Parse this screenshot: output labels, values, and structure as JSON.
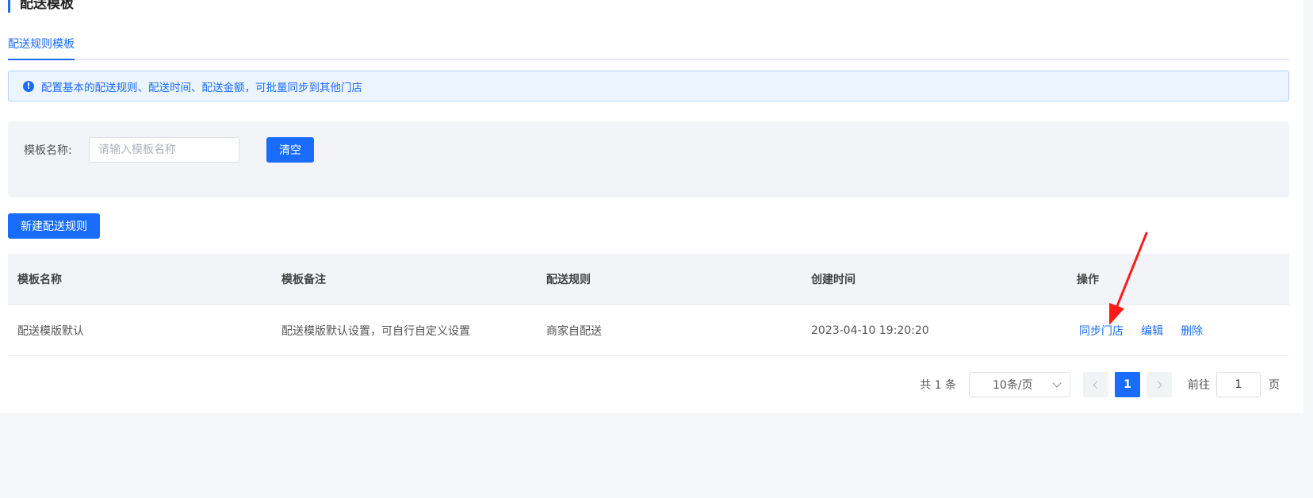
{
  "page": {
    "title": "配送模板",
    "tabs": [
      {
        "label": "配送规则模板",
        "active": true
      }
    ],
    "notice": "配置基本的配送规则、配送时间、配送金额，可批量同步到其他门店"
  },
  "filter": {
    "label": "模板名称:",
    "placeholder": "请输入模板名称",
    "value": "",
    "clear_label": "清空"
  },
  "actions": {
    "new_rule_label": "新建配送规则"
  },
  "table": {
    "headers": [
      "模板名称",
      "模板备注",
      "配送规则",
      "创建时间",
      "操作"
    ],
    "rows": [
      {
        "name": "配送模版默认",
        "remark": "配送模版默认设置，可自行自定义设置",
        "rule": "商家自配送",
        "created": "2023-04-10 19:20:20",
        "ops": [
          "同步门店",
          "编辑",
          "删除"
        ]
      }
    ]
  },
  "pagination": {
    "total": "共 1 条",
    "page_size": "10条/页",
    "current_page": "1",
    "goto_label": "前往",
    "goto_value": "1",
    "page_suffix": "页"
  },
  "colors": {
    "accent": "#1a6cff",
    "annotation_arrow": "#ff1a1a"
  }
}
